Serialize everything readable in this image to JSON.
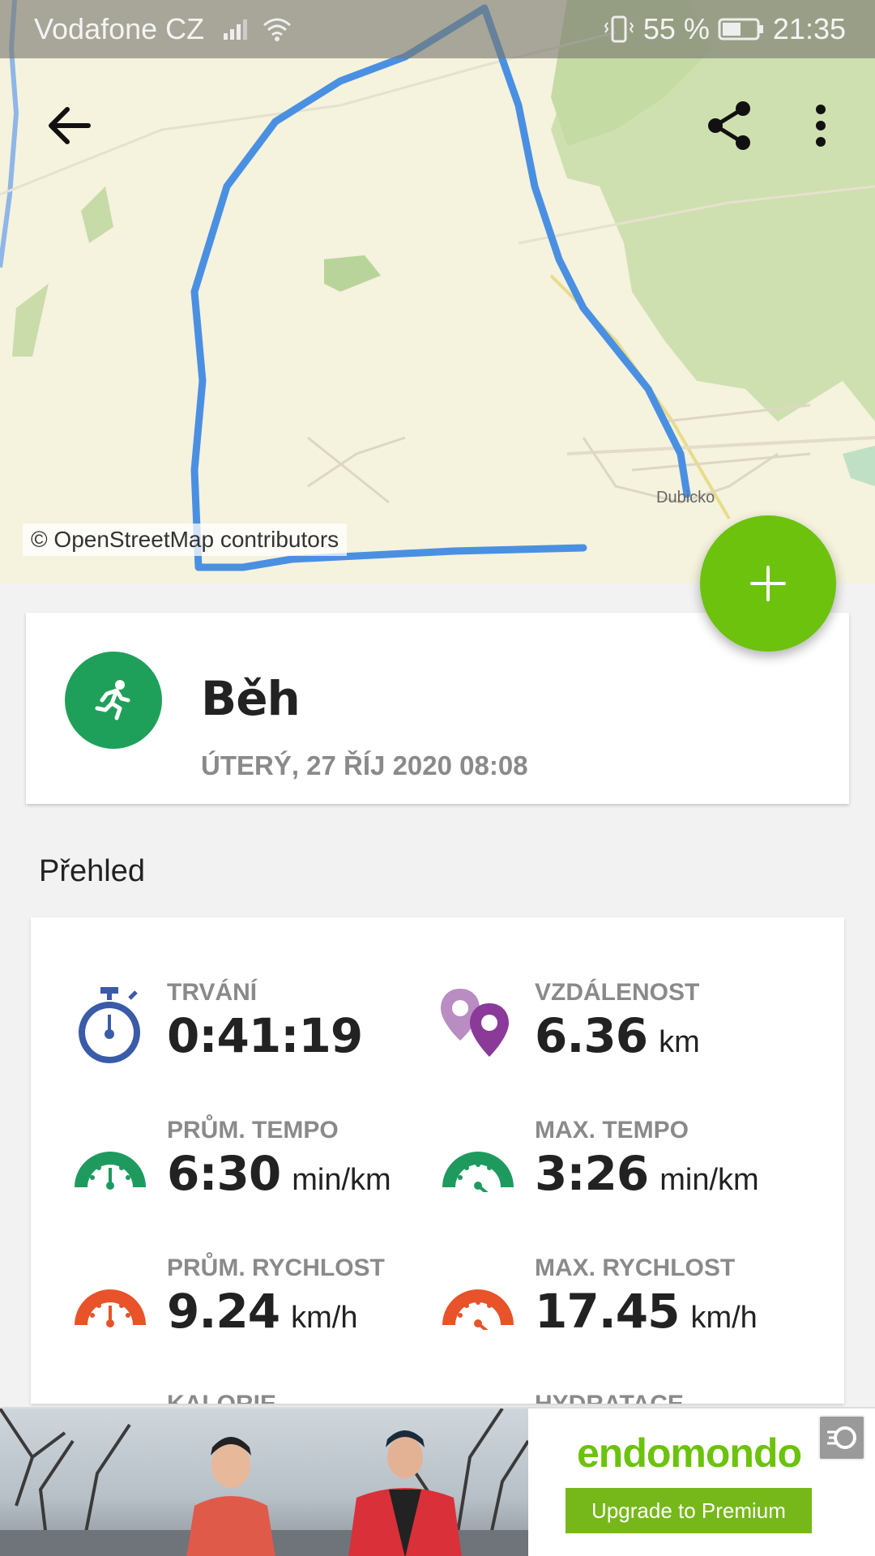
{
  "status_bar": {
    "carrier": "Vodafone CZ",
    "battery": "55 %",
    "time": "21:35"
  },
  "map": {
    "attribution": "© OpenStreetMap contributors",
    "place_label": "Dubicko"
  },
  "toolbar": {
    "back_icon": "arrow-left-icon",
    "share_icon": "share-icon",
    "more_icon": "more-vert-icon"
  },
  "fab": {
    "icon": "plus-icon"
  },
  "activity": {
    "sport": "Běh",
    "date": "ÚTERÝ, 27 ŘÍJ 2020 08:08",
    "icon": "running-icon",
    "color": "#1fa05a"
  },
  "overview": {
    "title": "Přehled",
    "stats": [
      {
        "label": "TRVÁNÍ",
        "value": "0:41:19",
        "unit": "",
        "icon": "stopwatch-icon",
        "color": "#3a5ba8"
      },
      {
        "label": "VZDÁLENOST",
        "value": "6.36",
        "unit": "km",
        "icon": "map-pins-icon",
        "color": "#8b3a99"
      },
      {
        "label": "PRŮM. TEMPO",
        "value": "6:30",
        "unit": "min/km",
        "icon": "gauge-icon",
        "color": "#1f9a5e"
      },
      {
        "label": "MAX. TEMPO",
        "value": "3:26",
        "unit": "min/km",
        "icon": "gauge-icon",
        "color": "#1f9a5e"
      },
      {
        "label": "PRŮM. RYCHLOST",
        "value": "9.24",
        "unit": "km/h",
        "icon": "speedometer-icon",
        "color": "#e8532a"
      },
      {
        "label": "MAX. RYCHLOST",
        "value": "17.45",
        "unit": "km/h",
        "icon": "speedometer-icon",
        "color": "#e8532a"
      }
    ],
    "partial": [
      "KALORIE",
      "HYDRATACE"
    ]
  },
  "ad": {
    "brand": "endomondo",
    "cta": "Upgrade to Premium",
    "brand_color": "#6cc20d"
  }
}
